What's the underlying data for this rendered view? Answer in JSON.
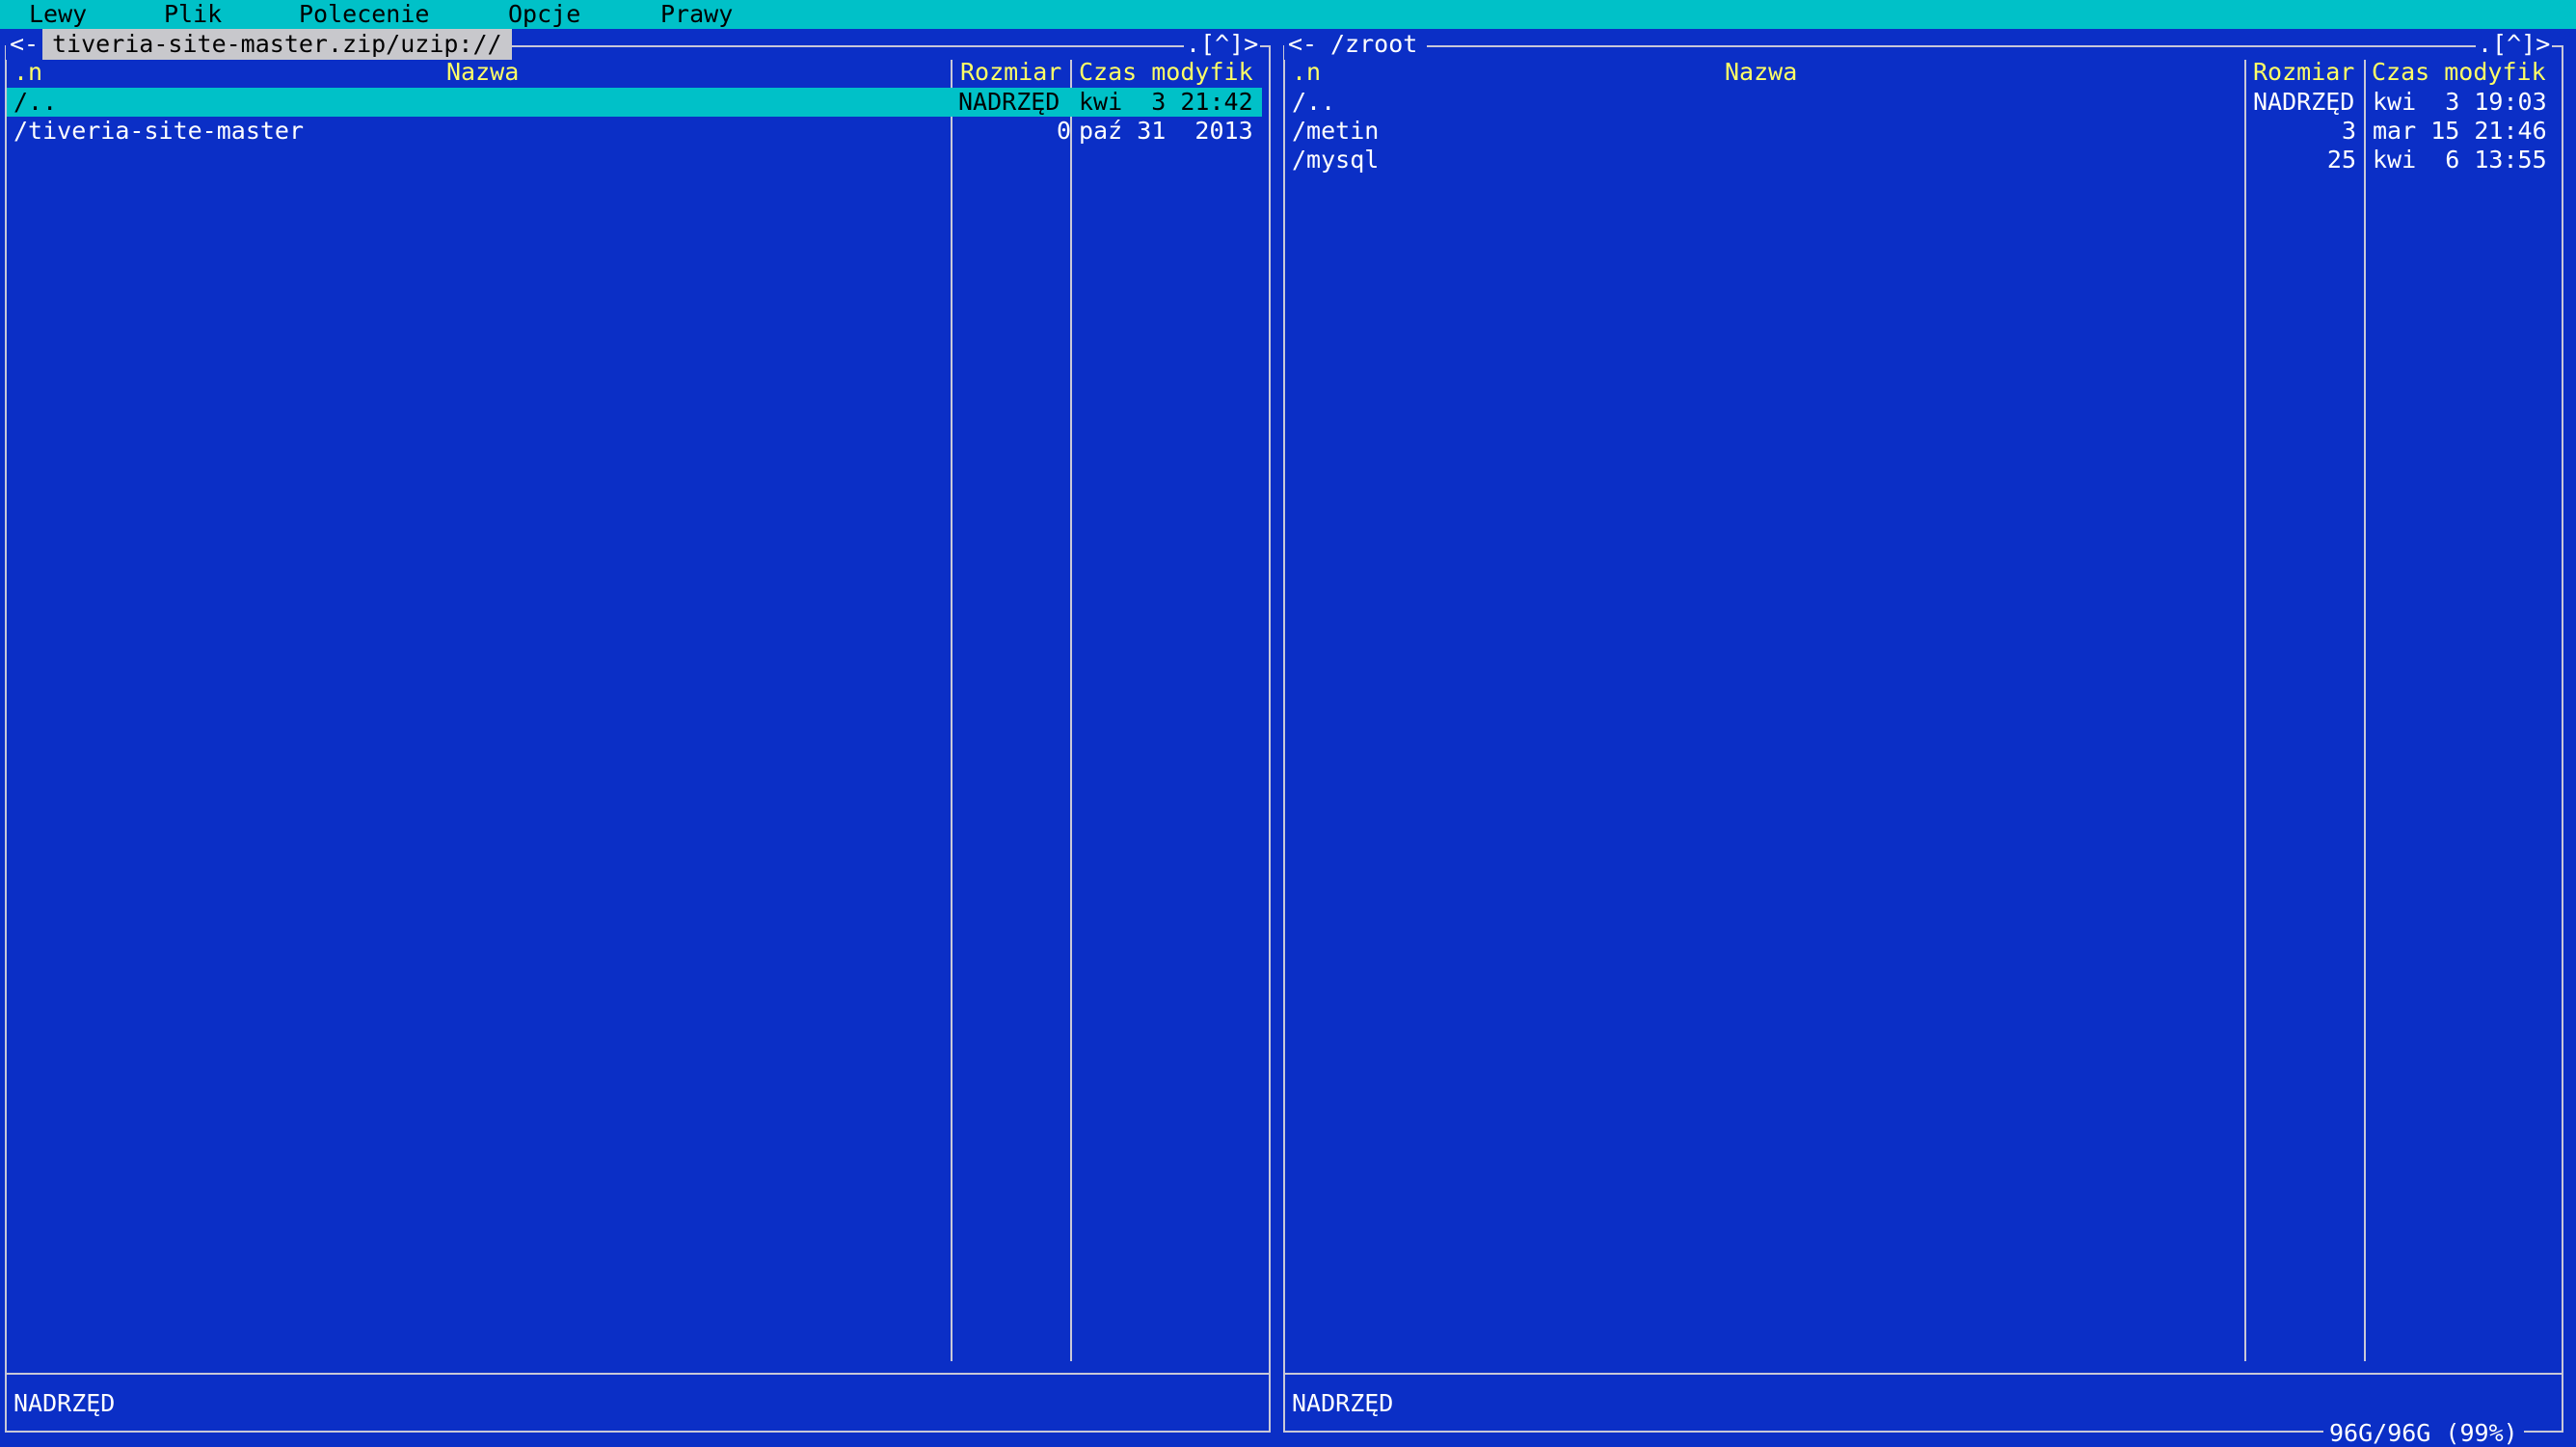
{
  "menu": [
    "Lewy",
    "Plik",
    "Polecenie",
    "Opcje",
    "Prawy"
  ],
  "left_panel": {
    "title_prefix": "<-",
    "path": "tiveria-site-master.zip/uzip://",
    "title_suffix": ".[^]>",
    "headers": {
      "sort": ".n",
      "name": "Nazwa",
      "size": "Rozmiar",
      "mtime": "Czas modyfik"
    },
    "rows": [
      {
        "name": "/..",
        "size": "NADRZĘD",
        "mtime": "kwi  3 21:42",
        "selected": true
      },
      {
        "name": "/tiveria-site-master",
        "size": "0",
        "mtime": "paź 31  2013",
        "selected": false
      }
    ],
    "status": "NADRZĘD"
  },
  "right_panel": {
    "title_prefix": "<-",
    "path": "/zroot",
    "title_suffix": ".[^]>",
    "headers": {
      "sort": ".n",
      "name": "Nazwa",
      "size": "Rozmiar",
      "mtime": "Czas modyfik"
    },
    "rows": [
      {
        "name": "/..",
        "size": "NADRZĘD",
        "mtime": "kwi  3 19:03",
        "selected": false
      },
      {
        "name": "/metin",
        "size": "3",
        "mtime": "mar 15 21:46",
        "selected": false
      },
      {
        "name": "/mysql",
        "size": "25",
        "mtime": "kwi  6 13:55",
        "selected": false
      }
    ],
    "status": "NADRZĘD",
    "disk_info": "96G/96G (99%)"
  },
  "colors": {
    "background": "#0b2fc6",
    "menubar": "#00c1c8",
    "selection": "#00c1c8",
    "header_text": "#ffff66",
    "frame": "#c8c8d8",
    "active_path_bg": "#c8c8cc"
  }
}
